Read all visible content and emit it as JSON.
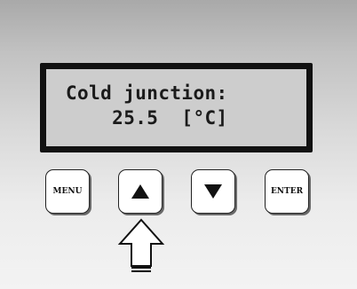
{
  "display": {
    "line1": "Cold junction:",
    "line2": "    25.5  [°C]"
  },
  "buttons": {
    "menu_label": "MENU",
    "up_icon": "triangle-up-icon",
    "down_icon": "triangle-down-icon",
    "enter_label": "ENTER"
  },
  "indicator": {
    "icon": "arrow-up-outline-icon",
    "points_to": "up"
  },
  "colors": {
    "lcd_background": "#cdcdcd",
    "lcd_frame": "#111111",
    "button_face": "#ffffff",
    "text": "#111111"
  }
}
